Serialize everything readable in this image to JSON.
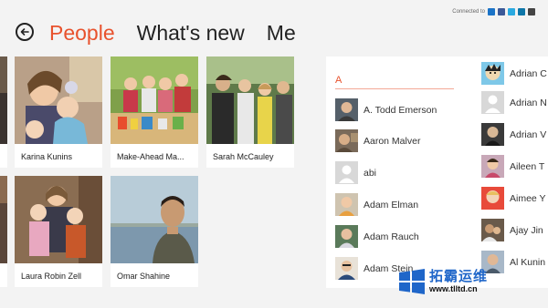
{
  "connected": {
    "label": "Connected to",
    "services": [
      "messenger-icon",
      "facebook-icon",
      "twitter-icon",
      "linkedin-icon",
      "more-icon"
    ]
  },
  "nav": {
    "back_icon": "back-arrow-icon",
    "tabs": [
      "People",
      "What's new",
      "Me"
    ],
    "active_tab": 0
  },
  "tiles": [
    {
      "name": "Karina Kunins"
    },
    {
      "name": "Make-Ahead Ma..."
    },
    {
      "name": "Sarah McCauley"
    },
    {
      "name": "Laura Robin Zell"
    },
    {
      "name": "Omar Shahine"
    }
  ],
  "contacts": {
    "group_letter": "A",
    "column1": [
      {
        "name": "A. Todd Emerson"
      },
      {
        "name": "Aaron Malver"
      },
      {
        "name": "abi"
      },
      {
        "name": "Adam Elman"
      },
      {
        "name": "Adam Rauch"
      },
      {
        "name": "Adam Stein"
      }
    ],
    "column2": [
      {
        "name": "Adrian C"
      },
      {
        "name": "Adrian N"
      },
      {
        "name": "Adrian V"
      },
      {
        "name": "Aileen T"
      },
      {
        "name": "Aimee Y"
      },
      {
        "name": "Ajay Jin"
      },
      {
        "name": "Al Kunin"
      }
    ]
  },
  "watermark": {
    "title": "拓霸运维",
    "url": "www.tlltd.cn",
    "logo_letter": "W"
  },
  "colors": {
    "accent": "#e8522d",
    "background": "#f3f3f3",
    "watermark_blue": "#1f66c9"
  }
}
